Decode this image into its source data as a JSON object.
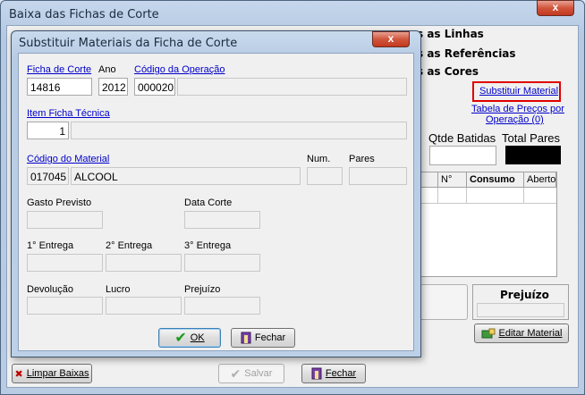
{
  "outer": {
    "title": "Baixa das Fichas de Corte",
    "close": "x",
    "right_labels": [
      "s as Linhas",
      "s as Referências",
      "s as Cores"
    ],
    "substituir_material": "Substituir Material",
    "tabela_precos": "Tabela de Preços por",
    "tabela_precos_2": "Operação (0)",
    "qtde_batidas": "Qtde Batidas",
    "total_pares": "Total Pares",
    "grid_cols": [
      "N°",
      "Consumo",
      "Aberto"
    ],
    "prejuizo": "Prejuízo",
    "editar_material": "Editar Material",
    "limpar_baixas": "Limpar Baixas",
    "salvar": "Salvar",
    "fechar": "Fechar"
  },
  "dialog": {
    "title": "Substituir Materiais da Ficha de Corte",
    "close": "x",
    "ficha_label": "Ficha de Corte",
    "ano_label": "Ano",
    "codigo_operacao_label": "Código da Operação",
    "ficha_value": "14816",
    "ano_value": "2012",
    "operacao_value": "000020",
    "item_ficha_label": "Item Ficha Técnica",
    "item_ficha_value": "1",
    "codigo_material_label": "Código do Material",
    "num_label": "Num.",
    "pares_label": "Pares",
    "material_code": "017045",
    "material_name": "ALCOOL",
    "gasto_previsto": "Gasto Previsto",
    "data_corte": "Data Corte",
    "entrega1": "1° Entrega",
    "entrega2": "2° Entrega",
    "entrega3": "3° Entrega",
    "devolucao": "Devolução",
    "lucro": "Lucro",
    "prejuizo": "Prejuízo",
    "ok": "OK",
    "fechar": "Fechar"
  },
  "colors": {
    "accent_link": "#0000cc",
    "highlight": "#e00000"
  }
}
